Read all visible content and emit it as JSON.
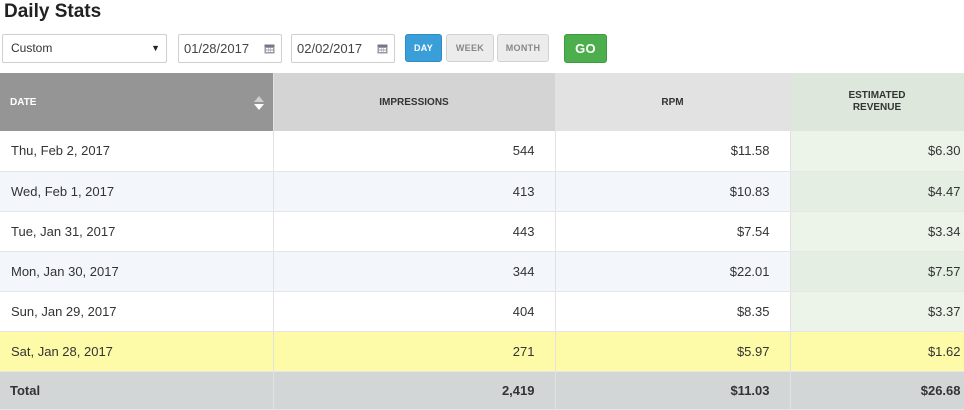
{
  "page": {
    "title": "Daily Stats"
  },
  "controls": {
    "range_select": "Custom",
    "start_date": "01/28/2017",
    "end_date": "02/02/2017",
    "period_buttons": {
      "day": "DAY",
      "week": "WEEK",
      "month": "MONTH"
    },
    "active_period": "day",
    "go_label": "GO"
  },
  "table": {
    "headers": {
      "date": "DATE",
      "impressions": "IMPRESSIONS",
      "rpm": "RPM",
      "revenue_line1": "ESTIMATED",
      "revenue_line2": "REVENUE"
    },
    "rows": [
      {
        "date": "Thu, Feb 2, 2017",
        "impressions": "544",
        "rpm": "$11.58",
        "revenue": "$6.30"
      },
      {
        "date": "Wed, Feb 1, 2017",
        "impressions": "413",
        "rpm": "$10.83",
        "revenue": "$4.47"
      },
      {
        "date": "Tue, Jan 31, 2017",
        "impressions": "443",
        "rpm": "$7.54",
        "revenue": "$3.34"
      },
      {
        "date": "Mon, Jan 30, 2017",
        "impressions": "344",
        "rpm": "$22.01",
        "revenue": "$7.57"
      },
      {
        "date": "Sun, Jan 29, 2017",
        "impressions": "404",
        "rpm": "$8.35",
        "revenue": "$3.37"
      },
      {
        "date": "Sat, Jan 28, 2017",
        "impressions": "271",
        "rpm": "$5.97",
        "revenue": "$1.62"
      }
    ],
    "total": {
      "label": "Total",
      "impressions": "2,419",
      "rpm": "$11.03",
      "revenue": "$26.68"
    }
  },
  "colors": {
    "accent_blue": "#3a9fd8",
    "go_green": "#4cae4c",
    "highlight_row": "#fdfba8",
    "header_dark": "#959595"
  },
  "icons": {
    "select_caret": "caret-down-icon",
    "calendar": "calendar-icon",
    "sort": "sort-icon"
  }
}
